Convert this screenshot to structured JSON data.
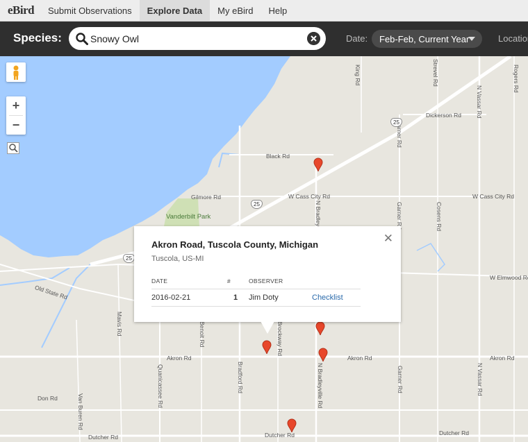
{
  "nav": {
    "logo": "eBird",
    "items": [
      {
        "label": "Submit Observations",
        "active": false
      },
      {
        "label": "Explore Data",
        "active": true
      },
      {
        "label": "My eBird",
        "active": false
      },
      {
        "label": "Help",
        "active": false
      }
    ]
  },
  "species_bar": {
    "label": "Species:",
    "search_value": "Snowy Owl",
    "date_label": "Date:",
    "date_value": "Feb-Feb, Current Year",
    "location_label": "Location"
  },
  "map": {
    "water_color": "#a3ccff",
    "land_color": "#e8e6df",
    "road_color": "#ffffff",
    "marker_color": "#e8472b",
    "park_name": "Vanderbilt Park",
    "road_labels": [
      "King Rd",
      "Strevel Rd",
      "Rogers Rd",
      "N Vassar Rd",
      "Dickerson Rd",
      "Black Rd",
      "Garner Rd",
      "Gilmore Rd",
      "W Cass City Rd",
      "N Bradleyville Rd",
      "Cosens Rd",
      "Old State Rd",
      "Mavis Rd",
      "Benoit Rd",
      "W Elmwood Rd",
      "Brockway Rd",
      "Akron Rd",
      "Quanicassee Rd",
      "Bradford Rd",
      "Don Rd",
      "Van Buren Rd",
      "Dutcher Rd"
    ],
    "highway_number": "25"
  },
  "info_window": {
    "title": "Akron Road, Tuscola County, Michigan",
    "subtitle": "Tuscola, US-MI",
    "columns": {
      "date": "DATE",
      "count": "#",
      "observer": "OBSERVER"
    },
    "row": {
      "date": "2016-02-21",
      "count": "1",
      "observer": "Jim Doty",
      "link": "Checklist"
    },
    "close_glyph": "✕"
  }
}
